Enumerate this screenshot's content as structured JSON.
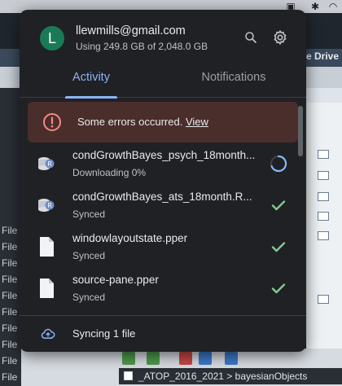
{
  "background": {
    "sidebar_rows": [
      "File",
      "File",
      "File",
      "File",
      "File",
      "File",
      "File",
      "File",
      "File",
      "File"
    ],
    "drive_label": "e Drive",
    "path_text": "_ATOP_2016_2021 > bayesianObjects"
  },
  "account": {
    "avatar_letter": "L",
    "email": "llewmills@gmail.com",
    "usage": "Using 249.8 GB of 2,048.0 GB"
  },
  "tabs": {
    "activity": "Activity",
    "notifications": "Notifications"
  },
  "error": {
    "message": "Some errors occurred.",
    "link": "View"
  },
  "files": [
    {
      "name": "condGrowthBayes_psych_18month...",
      "status": "Downloading 0%",
      "icon": "r-data-file-icon",
      "action": "progress-spinner-icon"
    },
    {
      "name": "condGrowthBayes_ats_18month.R...",
      "status": "Synced",
      "icon": "r-data-file-icon",
      "action": "checkmark-icon"
    },
    {
      "name": "windowlayoutstate.pper",
      "status": "Synced",
      "icon": "document-icon",
      "action": "checkmark-icon"
    },
    {
      "name": "source-pane.pper",
      "status": "Synced",
      "icon": "document-icon",
      "action": "checkmark-icon"
    }
  ],
  "footer": {
    "text": "Syncing 1 file"
  },
  "colors": {
    "accent": "#8ab4f8",
    "avatar": "#1a7a57",
    "error_bg": "#4a2e2c",
    "error_icon": "#f28b82",
    "synced": "#81c995"
  }
}
